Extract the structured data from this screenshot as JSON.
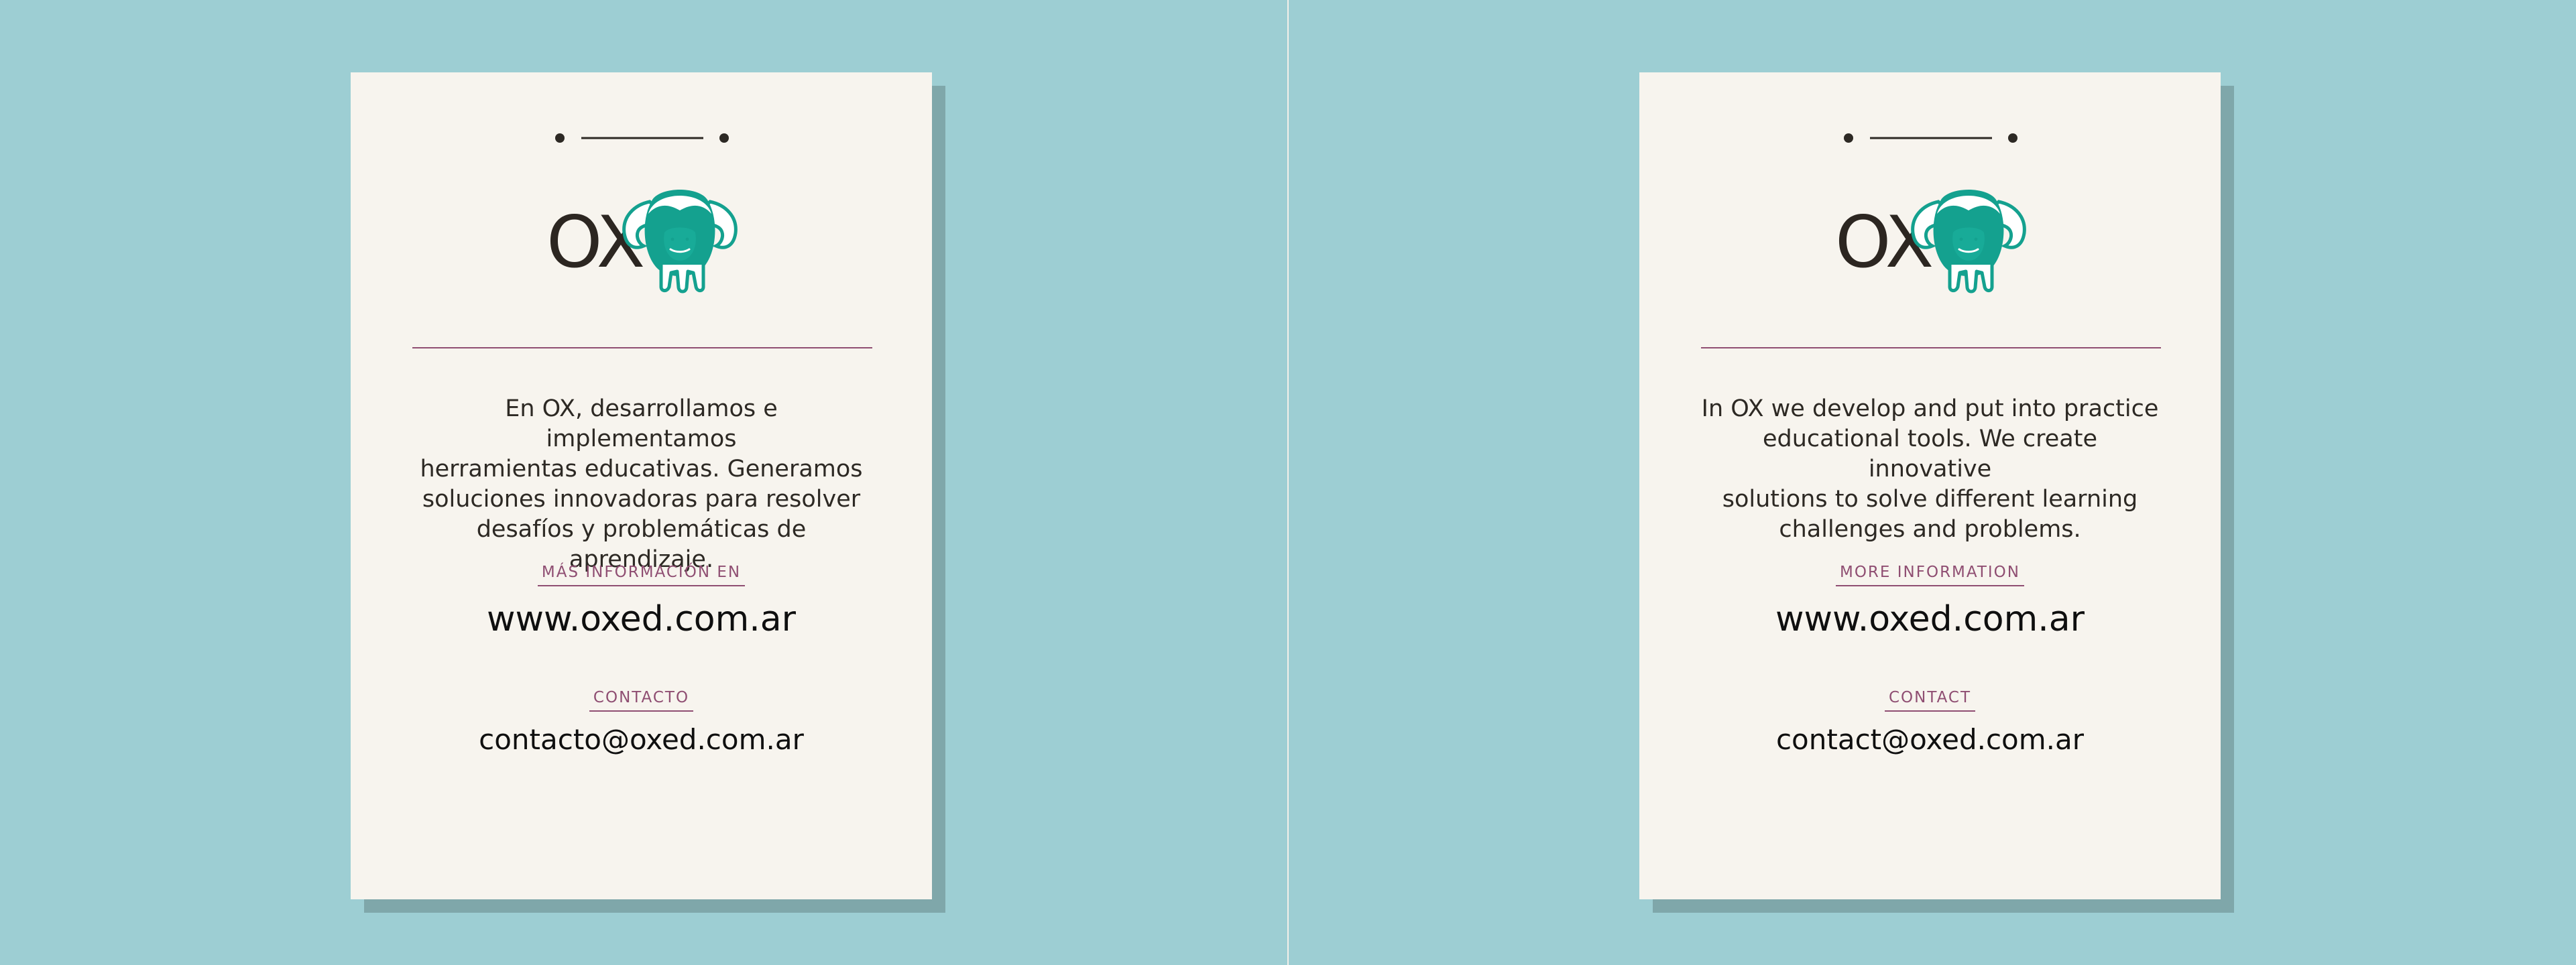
{
  "colors": {
    "background": "#9dced3",
    "card": "#f7f4ee",
    "shadow": "#7fa7aa",
    "accent_teal": "#14a18f",
    "accent_plum": "#8f4e72",
    "text_dark": "#2d2924",
    "text_black": "#0f0f0f"
  },
  "brand": {
    "wordmark": "OX",
    "mascot_icon": "ox-mascot"
  },
  "cards": [
    {
      "description": "En OX, desarrollamos e implementamos\nherramientas educativas. Generamos\nsoluciones innovadoras para resolver\ndesafíos y problemáticas de aprendizaje.",
      "info_label": "MÁS INFORMACIÓN EN",
      "website": "www.oxed.com.ar",
      "contact_label": "CONTACTO",
      "email": "contacto@oxed.com.ar"
    },
    {
      "description": "In OX we develop and put into practice\neducational tools. We create innovative\nsolutions to solve different learning\nchallenges and problems.",
      "info_label": "MORE INFORMATION",
      "website": "www.oxed.com.ar",
      "contact_label": "CONTACT",
      "email": "contact@oxed.com.ar"
    }
  ]
}
